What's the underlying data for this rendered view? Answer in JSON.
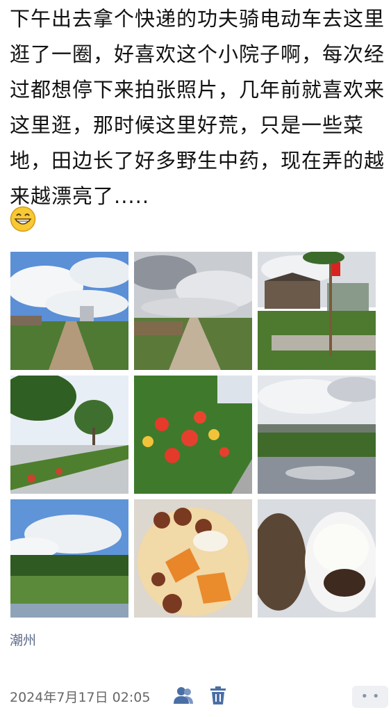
{
  "post": {
    "text": "下午出去拿个快递的功夫骑电动车去这里逛了一圈，好喜欢这个小院子啊，每次经过都想停下来拍张照片，几年前就喜欢来这里逛，那时候这里好荒，只是一些菜地，田边长了好多野生中药，现在弄的越来越漂亮了.....",
    "emoji": "grinning-face-emoji"
  },
  "photos": [
    {
      "subject": "dirt path between fields under cloudy blue sky"
    },
    {
      "subject": "narrow concrete path through farmland, overcast"
    },
    {
      "subject": "small courtyard with red flag and greenery"
    },
    {
      "subject": "roadside trees and flower beds"
    },
    {
      "subject": "red ixora flowers with yellow blossoms"
    },
    {
      "subject": "flooded field reflecting clouds"
    },
    {
      "subject": "green field with water under blue sky"
    },
    {
      "subject": "bowl of dessert soup with sweet potato"
    },
    {
      "subject": "rice and braised meat in bowls"
    }
  ],
  "location": "潮州",
  "footer": {
    "date": "2024年7月17日 02:05",
    "group_icon": "people-icon",
    "trash_icon": "trash-icon",
    "more_label": "• •"
  },
  "colors": {
    "link": "#5a6a88",
    "icon": "#4a6fa5",
    "text": "#111111"
  }
}
